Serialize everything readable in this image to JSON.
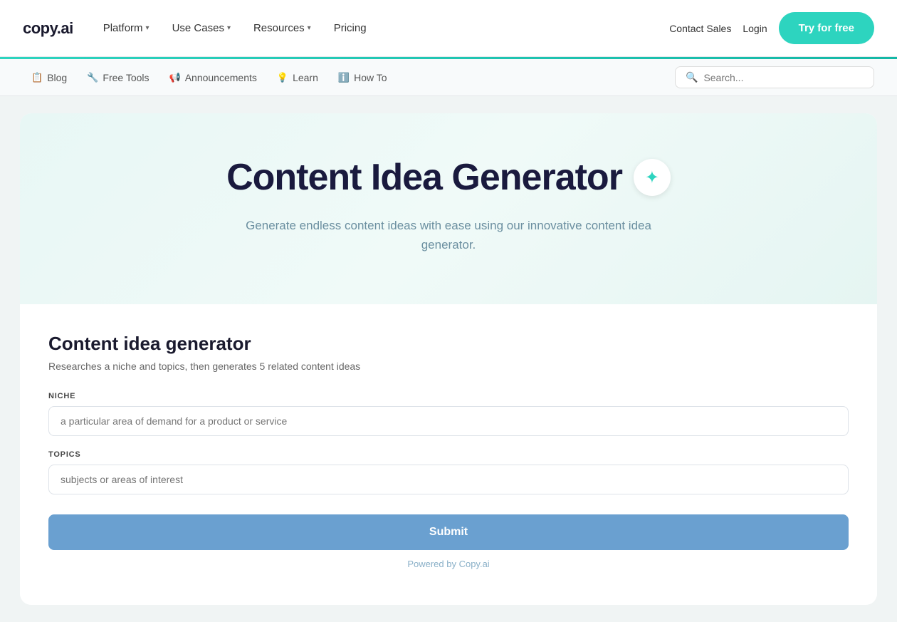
{
  "logo": {
    "text": "copy.ai"
  },
  "nav": {
    "items": [
      {
        "label": "Platform",
        "hasDropdown": true
      },
      {
        "label": "Use Cases",
        "hasDropdown": true
      },
      {
        "label": "Resources",
        "hasDropdown": true
      },
      {
        "label": "Pricing",
        "hasDropdown": false
      }
    ],
    "contact_sales": "Contact Sales",
    "login": "Login",
    "try_free": "Try for free"
  },
  "sub_nav": {
    "items": [
      {
        "icon": "📋",
        "label": "Blog"
      },
      {
        "icon": "🔧",
        "label": "Free Tools"
      },
      {
        "icon": "📢",
        "label": "Announcements"
      },
      {
        "icon": "💡",
        "label": "Learn"
      },
      {
        "icon": "ℹ️",
        "label": "How To"
      }
    ],
    "search_placeholder": "Search..."
  },
  "hero": {
    "title": "Content Idea Generator",
    "sparkle_symbol": "✦",
    "subtitle": "Generate endless content ideas with ease using our innovative content idea generator."
  },
  "form": {
    "title": "Content idea generator",
    "subtitle": "Researches a niche and topics, then generates 5 related content ideas",
    "niche_label": "NICHE",
    "niche_placeholder": "a particular area of demand for a product or service",
    "topics_label": "TOPICS",
    "topics_placeholder": "subjects or areas of interest",
    "submit_label": "Submit",
    "powered_by": "Powered by Copy.ai"
  }
}
